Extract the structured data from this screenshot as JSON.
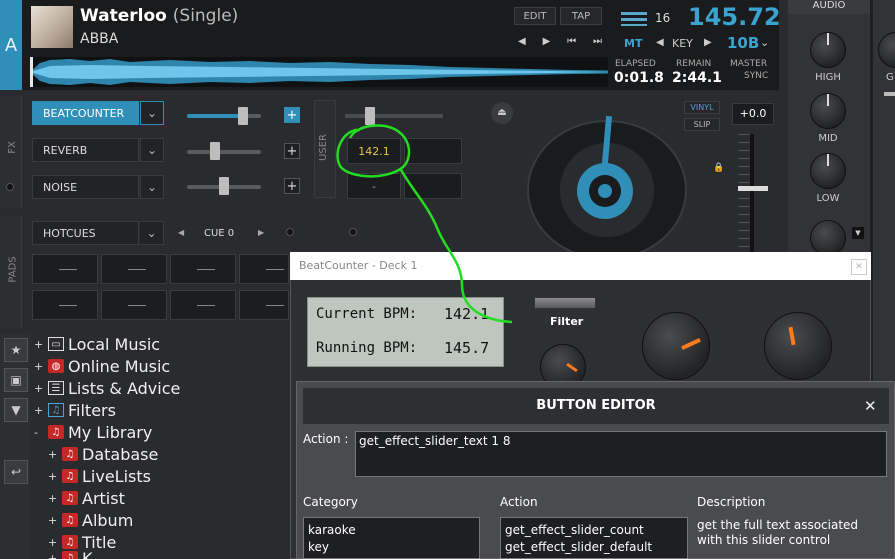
{
  "deck": {
    "letter": "A",
    "title": "Waterloo",
    "title_suffix": "(Single)",
    "artist": "ABBA",
    "edit_label": "EDIT",
    "tap_label": "TAP",
    "bpm": "145.72",
    "beat_count": "16",
    "mt_label": "MT",
    "key_label": "KEY",
    "key_value": "10B",
    "elapsed_label": "ELAPSED",
    "elapsed_value": "0:01.8",
    "remain_label": "REMAIN",
    "remain_value": "2:44.1",
    "master_label": "MASTER",
    "sync_label": "SYNC",
    "vinyl_label": "VINYL",
    "slip_label": "SLIP",
    "pitch_value": "+0.0"
  },
  "fx": {
    "side_label": "FX",
    "slots": [
      {
        "name": "BEATCOUNTER",
        "active": true,
        "level": 0.8
      },
      {
        "name": "REVERB",
        "active": false,
        "level": 0.4
      },
      {
        "name": "NOISE",
        "active": false,
        "level": 0.5
      }
    ]
  },
  "user": {
    "side_label": "USER",
    "button_value": "142.1",
    "dash": "-"
  },
  "pads": {
    "side_label": "PADS",
    "mode": "HOTCUES",
    "cue_label": "CUE 0"
  },
  "mixer": {
    "audio_label": "AUDIO",
    "high": "HIGH",
    "mid": "MID",
    "low": "LOW",
    "gain_partial": "G"
  },
  "browser": {
    "items": [
      {
        "label": "Local Music",
        "expander": "+",
        "icon": "monitor-icon"
      },
      {
        "label": "Online Music",
        "expander": "+",
        "icon": "globe-icon"
      },
      {
        "label": "Lists & Advice",
        "expander": "+",
        "icon": "list-icon"
      },
      {
        "label": "Filters",
        "expander": "+",
        "icon": "filter-icon"
      },
      {
        "label": "My Library",
        "expander": "-",
        "icon": "library-icon"
      },
      {
        "label": "Database",
        "expander": "+",
        "icon": "library-icon"
      },
      {
        "label": "LiveLists",
        "expander": "+",
        "icon": "library-icon"
      },
      {
        "label": "Artist",
        "expander": "+",
        "icon": "library-icon"
      },
      {
        "label": "Album",
        "expander": "+",
        "icon": "library-icon"
      },
      {
        "label": "Title",
        "expander": "+",
        "icon": "library-icon"
      },
      {
        "label": "K",
        "expander": "+",
        "icon": "library-icon"
      }
    ]
  },
  "beatcounter_window": {
    "title": "BeatCounter - Deck 1",
    "current_label": "Current BPM:",
    "current_value": "142.1",
    "running_label": "Running BPM:",
    "running_value": "145.7",
    "filter_label": "Filter"
  },
  "button_editor": {
    "title": "BUTTON EDITOR",
    "action_label": "Action :",
    "action_value": "get_effect_slider_text 1 8",
    "category_label": "Category",
    "category_items": [
      "karaoke",
      "key"
    ],
    "action_col_label": "Action",
    "action_items": [
      "get_effect_slider_count",
      "get_effect_slider_default"
    ],
    "description_label": "Description",
    "description_text": "get the full text associated with this slider control"
  },
  "colors": {
    "accent": "#2f8fb8",
    "annotation": "#22dd22",
    "knob_indicator": "#ff7a1a"
  }
}
